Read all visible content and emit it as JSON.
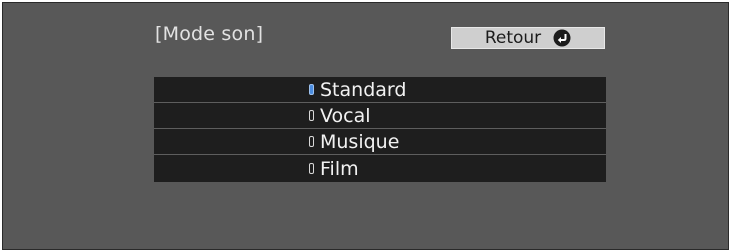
{
  "screen": {
    "title": "[Mode son]",
    "back_button": {
      "label": "Retour",
      "icon": "return-arrow-icon"
    }
  },
  "menu": {
    "items": [
      {
        "label": "Standard",
        "selected": true
      },
      {
        "label": "Vocal",
        "selected": false
      },
      {
        "label": "Musique",
        "selected": false
      },
      {
        "label": "Film",
        "selected": false
      }
    ]
  },
  "colors": {
    "background": "#585858",
    "menu_item_bg": "#1e1e1e",
    "selected_indicator": "#4b8de0",
    "button_bg": "#cfcfcf"
  }
}
